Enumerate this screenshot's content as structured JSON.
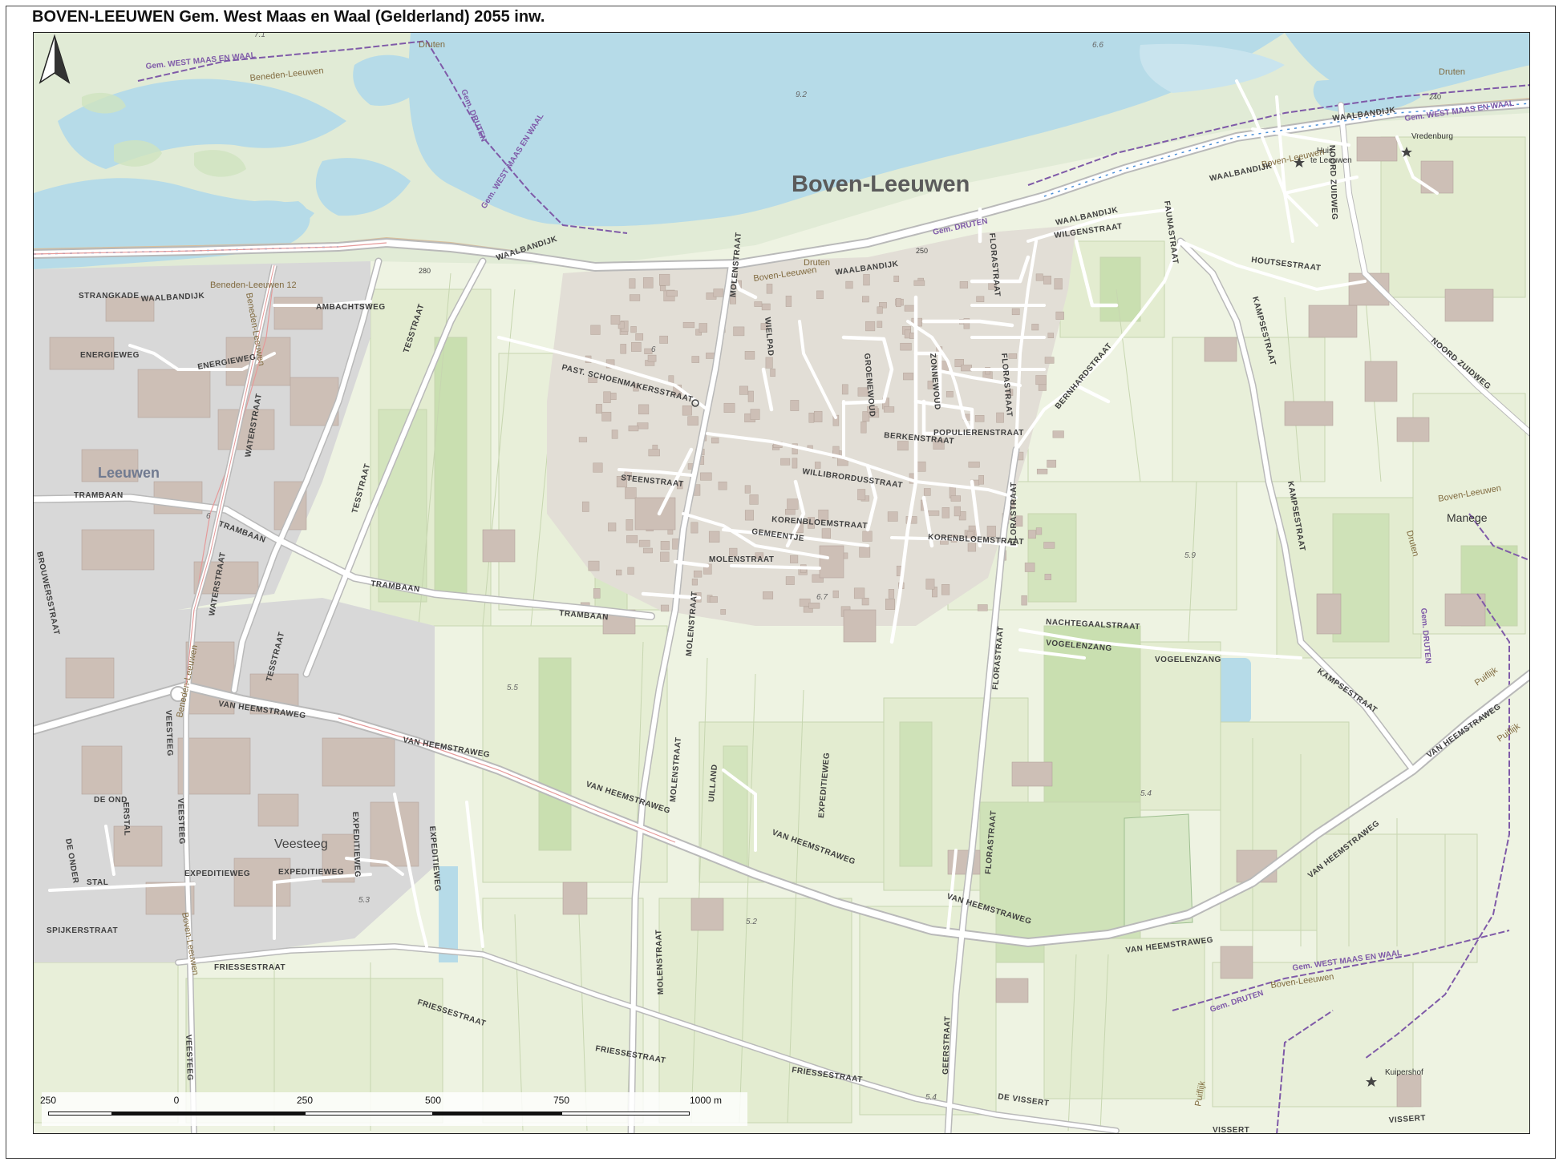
{
  "page": {
    "title": "BOVEN-LEEUWEN  Gem. West Maas en Waal (Gelderland) 2055 inw."
  },
  "colors": {
    "water": "#b6dbe8",
    "land": "#eef3e2",
    "field": "#e3ecd0",
    "field_dark": "#c9dfb0",
    "urban": "#d8d8d8",
    "building": "#cdbfb6",
    "road": "#ffffff",
    "road_casing": "#b9b9b9",
    "label": "#3f3f3f",
    "boundary": "#7f5aa8",
    "street_blue": "#4a8fd8"
  },
  "map": {
    "places": {
      "main": "Boven-Leeuwen",
      "leeuwen": "Leeuwen",
      "veesteeg": "Veesteeg",
      "manege": "Manege",
      "huis_te_leeuwen_1": "Huis",
      "huis_te_leeuwen_2": "te Leeuwen",
      "vredenburg": "Vredenburg",
      "kuipershof": "Kuipershof",
      "druten_1": "Druten",
      "druten_2": "Druten",
      "druten_3": "Druten",
      "druten_4": "Druten",
      "puiflijk_1": "Puiflijk",
      "puiflijk_2": "Puiflijk",
      "puiflijk_3": "Puiflijk",
      "beneden_leeuwen_1": "Beneden-Leeuwen",
      "beneden_leeuwen_2": "Beneden-Leeuwen 12",
      "beneden_leeuwen_3": "Beneden-Leeuwen",
      "beneden_leeuwen_4": "Beneden-Leeuwen",
      "boven_leeuwen_1": "Boven-Leeuwen",
      "boven_leeuwen_2": "Boven-Leeuwen",
      "boven_leeuwen_3": "Boven-Leeuwen",
      "boven_leeuwen_4": "Boven-Leeuwen",
      "boven_leeuwen_5": "Boven-Leeuwen"
    },
    "boundaries": {
      "west_maas_1": "Gem. WEST MAAS EN WAAL",
      "west_maas_2": "Gem. WEST MAAS EN WAAL",
      "west_maas_3": "Gem. WEST MAAS EN WAAL",
      "west_maas_4": "Gem. WEST MAAS EN WAAL",
      "druten_1": "Gem. DRUTEN",
      "druten_2": "Gem. DRUTEN",
      "druten_3": "Gem. DRUTEN",
      "druten_4": "Gem. DRUTEN"
    },
    "streets": {
      "waalbandijk_1": "WAALBANDIJK",
      "waalbandijk_2": "WAALBANDIJK",
      "waalbandijk_3": "WAALBANDIJK",
      "waalbandijk_4": "WAALBANDIJK",
      "waalbandijk_5": "WAALBANDIJK",
      "waalbandijk_6": "WAALBANDIJK",
      "strangkade": "STRANGKADE",
      "ambachtsweg": "AMBACHTSWEG",
      "energieweg_1": "ENERGIEWEG",
      "energieweg_2": "ENERGIEWEG",
      "tesstraat_1": "TESSTRAAT",
      "tesstraat_2": "TESSTRAAT",
      "tesstraat_3": "TESSTRAAT",
      "waterstraat_1": "WATERSTRAAT",
      "waterstraat_2": "WATERSTRAAT",
      "trambaan_1": "TRAMBAAN",
      "trambaan_2": "TRAMBAAN",
      "trambaan_3": "TRAMBAAN",
      "trambaan_4": "TRAMBAAN",
      "brouwersstraat": "BROUWERSSTRAAT",
      "van_heemstraweg_1": "VAN HEEMSTRAWEG",
      "van_heemstraweg_2": "VAN HEEMSTRAWEG",
      "van_heemstraweg_3": "VAN HEEMSTRAWEG",
      "van_heemstraweg_4": "VAN HEEMSTRAWEG",
      "van_heemstraweg_5": "VAN HEEMSTRAWEG",
      "van_heemstraweg_6": "VAN HEEMSTRAWEG",
      "van_heemstraweg_7": "VAN HEEMSTRAWEG",
      "van_heemstraweg_8": "VAN HEEMSTRAWEG",
      "veesteeg_1": "VEESTEEG",
      "veesteeg_2": "VEESTEEG",
      "veesteeg_3": "VEESTEEG",
      "de_ond": "DE OND",
      "erstal": "ERSTAL",
      "de_onder": "DE ONDER",
      "stal": "STAL",
      "expeditieweg_1": "EXPEDITIEWEG",
      "expeditieweg_2": "EXPEDITIEWEG",
      "expeditieweg_3": "EXPEDITIEWEG",
      "expeditieweg_4": "EXPEDITIEWEG",
      "spijkerstraat": "SPIJKERSTRAAT",
      "friessestraat_1": "FRIESSESTRAAT",
      "friessestraat_2": "FRIESSESTRAAT",
      "friessestraat_3": "FRIESSESTRAAT",
      "past_schoenmakersstraat": "PAST. SCHOENMAKERSSTRAAT",
      "steenstraat": "STEENSTRAAT",
      "molenstraat_1": "MOLENSTRAAT",
      "molenstraat_2": "MOLENSTRAAT",
      "molenstraat_3": "MOLENSTRAAT",
      "molenstraat_4": "MOLENSTRAAT",
      "molenstraat_5": "MOLENSTRAAT",
      "wielpad": "WIELPAD",
      "willibrordusstraat": "WILLIBRORDUSSTRAAT",
      "korenbloemstraat_1": "KORENBLOEMSTRAAT",
      "korenbloemstraat_2": "KORENBLOEMSTRAAT",
      "gemeentje": "GEMEENTJE",
      "groenewoud": "GROENEWOUD",
      "zonnewoud": "ZONNEWOUD",
      "berkenstraat": "BERKENSTRAAT",
      "populierenstraat": "POPULIERENSTRAAT",
      "florastraat_1": "FLORASTRAAT",
      "florastraat_2": "FLORASTRAAT",
      "florastraat_3": "FLORASTRAAT",
      "florastraat_4": "FLORASTRAAT",
      "florastraat_5": "FLORASTRAAT",
      "florastraat_6": "FLORASTRAAT",
      "wilgenstraat": "WILGENSTRAAT",
      "faunastraat": "FAUNASTRAAT",
      "bernhardstraat": "BERNHARDSTRAAT",
      "houtsestraat": "HOUTSESTRAAT",
      "kampsestraat_1": "KAMPSESTRAAT",
      "kampsestraat_2": "KAMPSESTRAAT",
      "kampsestraat_3": "KAMPSESTRAAT",
      "noord_zuidweg_1": "NOORD ZUIDWEG",
      "noord_zuidweg_2": "NOORD ZUIDWEG",
      "nachtegaalstraat": "NACHTEGAALSTRAAT",
      "vogelenzang_1": "VOGELENZANG",
      "vogelenzang_2": "VOGELENZANG",
      "uilland": "UILLAND",
      "expeditieweg_small": "EXPEDITIEWEG",
      "geerstraat": "GEERSTRAAT",
      "de_vissert": "DE VISSERT",
      "vissert_1": "VISSERT",
      "vissert_2": "VISSERT"
    },
    "spot_heights": {
      "h71": "7.1",
      "h92": "9.2",
      "h66": "6.6",
      "h6a": "6",
      "h6b": "6",
      "h67": "6.7",
      "h59": "5.9",
      "h55": "5.5",
      "h54a": "5.4",
      "h53": "5.3",
      "h52": "5.2",
      "h54b": "5.4"
    },
    "road_numbers": {
      "r280": "280",
      "r250": "250",
      "r240": "240"
    }
  },
  "scale_bar": {
    "labels": [
      "250",
      "0",
      "250",
      "500",
      "750",
      "1000 m"
    ]
  }
}
